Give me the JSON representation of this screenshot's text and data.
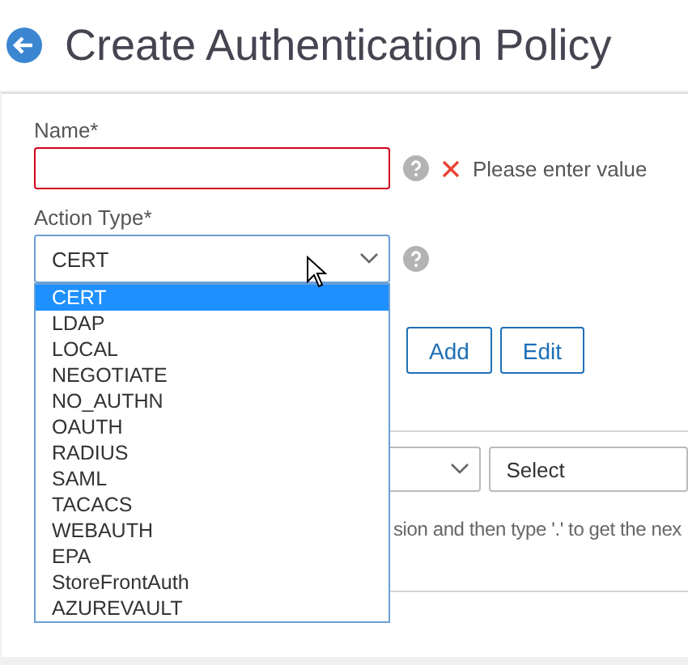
{
  "page_title": "Create Authentication Policy",
  "name_field": {
    "label": "Name*",
    "invalid": true,
    "error": "Please enter value"
  },
  "action_type": {
    "label": "Action Type*",
    "value": "CERT",
    "open": true,
    "options": [
      {
        "label": "CERT",
        "selected": true
      },
      {
        "label": "LDAP",
        "selected": false
      },
      {
        "label": "LOCAL",
        "selected": false
      },
      {
        "label": "NEGOTIATE",
        "selected": false
      },
      {
        "label": "NO_AUTHN",
        "selected": false
      },
      {
        "label": "OAUTH",
        "selected": false
      },
      {
        "label": "RADIUS",
        "selected": false
      },
      {
        "label": "SAML",
        "selected": false
      },
      {
        "label": "TACACS",
        "selected": false
      },
      {
        "label": "WEBAUTH",
        "selected": false
      },
      {
        "label": "EPA",
        "selected": false
      },
      {
        "label": "StoreFrontAuth",
        "selected": false
      },
      {
        "label": "AZUREVAULT",
        "selected": false
      }
    ]
  },
  "buttons": [
    "Add",
    "Edit"
  ],
  "expression": {
    "select_2": "Select",
    "hint": "sion and then type '.' to get the nex"
  }
}
